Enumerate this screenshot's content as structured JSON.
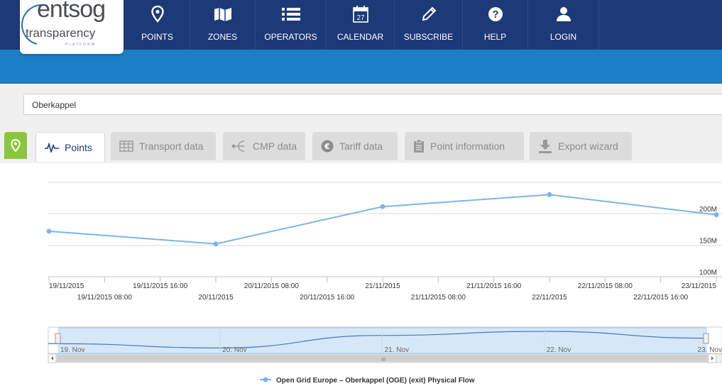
{
  "logo": {
    "line1": "entsog",
    "line2": "transparency",
    "line3": "PLATFORM"
  },
  "nav": [
    {
      "label": "POINTS",
      "icon": "map-pin-icon"
    },
    {
      "label": "ZONES",
      "icon": "map-icon"
    },
    {
      "label": "OPERATORS",
      "icon": "list-icon"
    },
    {
      "label": "CALENDAR",
      "icon": "calendar-icon",
      "day": "27"
    },
    {
      "label": "SUBSCRIBE",
      "icon": "pencil-icon"
    },
    {
      "label": "HELP",
      "icon": "help-icon"
    },
    {
      "label": "LOGIN",
      "icon": "user-icon"
    }
  ],
  "search": {
    "value": "Oberkappel"
  },
  "tabs": [
    {
      "label": "Points",
      "icon": "pulse-icon",
      "active": true
    },
    {
      "label": "Transport data",
      "icon": "table-icon"
    },
    {
      "label": "CMP data",
      "icon": "share-icon"
    },
    {
      "label": "Tariff data",
      "icon": "euro-icon"
    },
    {
      "label": "Point information",
      "icon": "clipboard-icon"
    },
    {
      "label": "Export wizard",
      "icon": "download-icon"
    }
  ],
  "colors": {
    "topbar": "#1d3a78",
    "bluebar": "#1a7fc6",
    "accent_green": "#8cc63f",
    "series": "#7cb5ec"
  },
  "chart_data": {
    "type": "line",
    "series": [
      {
        "name": "Open Grid Europe - Oberkappel (OGE) (exit) Physical Flow",
        "points": [
          {
            "x": "19/11/2015 00:00",
            "y": 172
          },
          {
            "x": "20/11/2015 00:00",
            "y": 152
          },
          {
            "x": "21/11/2015 00:00",
            "y": 211
          },
          {
            "x": "22/11/2015 00:00",
            "y": 230
          },
          {
            "x": "23/11/2015 00:00",
            "y": 198
          }
        ]
      }
    ],
    "y_ticks": [
      "100M",
      "150M",
      "200M"
    ],
    "ylim": [
      100,
      250
    ],
    "x_ticks_upper": [
      "19/11/2015",
      "19/11/2015 16:00",
      "20/11/2015 08:00",
      "21/11/2015",
      "21/11/2015 16:00",
      "22/11/2015 08:00",
      "23/11/2015"
    ],
    "x_ticks_lower": [
      "19/11/2015 08:00",
      "20/11/2015",
      "20/11/2015 16:00",
      "21/11/2015 08:00",
      "22/11/2015",
      "22/11/2015 16:00"
    ],
    "navigator_labels": [
      "19. Nov",
      "20. Nov",
      "21. Nov",
      "22. Nov",
      "23. Nov"
    ],
    "navigator_scroll_label": "III",
    "legend": "Open Grid Europe – Oberkappel (OGE) (exit) Physical Flow",
    "grid": true,
    "legend_position": "bottom-center"
  }
}
